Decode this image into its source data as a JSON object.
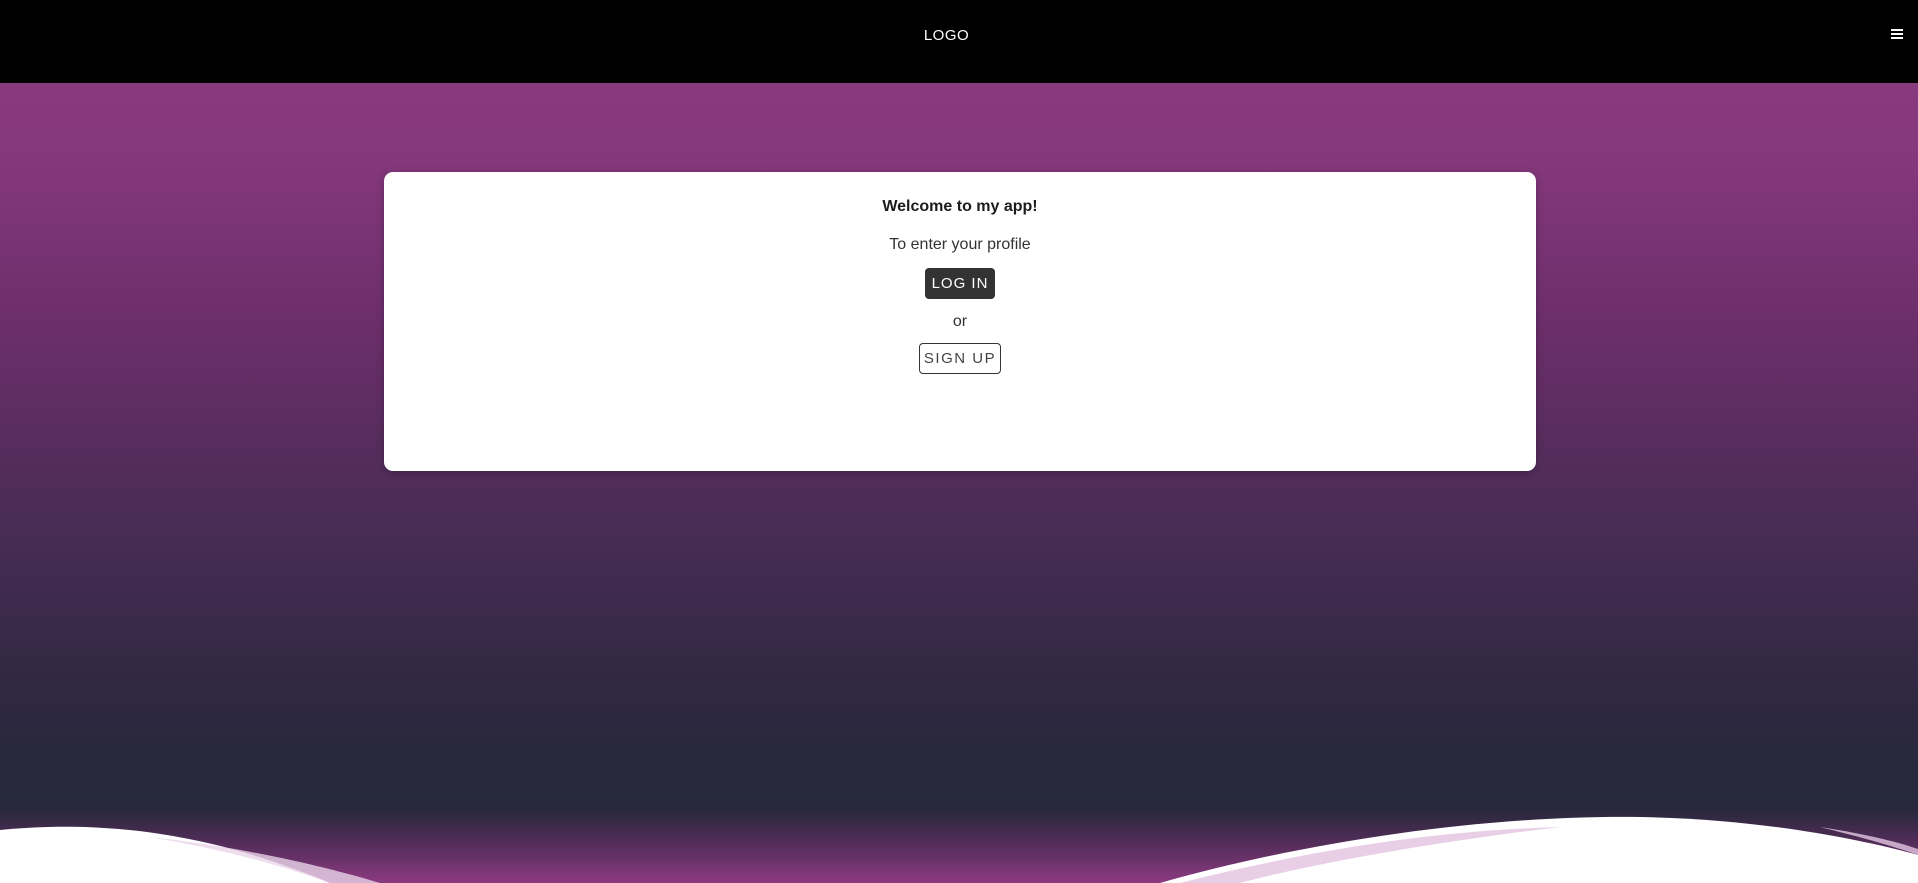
{
  "header": {
    "logo_text": "LOGO",
    "menu_icon": "hamburger-menu-icon"
  },
  "card": {
    "title": "Welcome to my app!",
    "subtitle": "To enter your profile",
    "login_label": "LOG IN",
    "separator": "or",
    "signup_label": "SIGN UP"
  },
  "colors": {
    "header_bg": "#000000",
    "background_top": "#8b3a80",
    "background_bottom": "#25283a",
    "card_bg": "#ffffff",
    "login_button_bg": "#333333",
    "wave": "#ffffff"
  }
}
